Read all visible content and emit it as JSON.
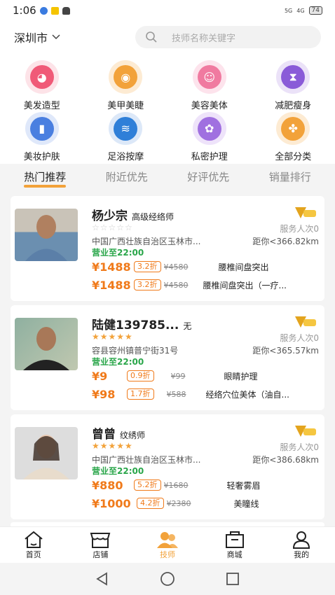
{
  "status": {
    "time": "1:06",
    "signal": "5G",
    "network": "4G",
    "battery": "74"
  },
  "header": {
    "city": "深圳市",
    "search_placeholder": "技师名称关键字"
  },
  "categories": [
    {
      "label": "美发造型",
      "icon": "hair-icon",
      "color": "#f05a78"
    },
    {
      "label": "美甲美睫",
      "icon": "eye-icon",
      "color": "#f2a23a"
    },
    {
      "label": "美容美体",
      "icon": "face-icon",
      "color": "#f07aa0"
    },
    {
      "label": "减肥瘦身",
      "icon": "body-icon",
      "color": "#8a5bd8"
    },
    {
      "label": "美妆护肤",
      "icon": "cosmetics-icon",
      "color": "#4a7fe0"
    },
    {
      "label": "足浴按摩",
      "icon": "foot-massage-icon",
      "color": "#2f7fd8"
    },
    {
      "label": "私密护理",
      "icon": "flower-icon",
      "color": "#a070e0"
    },
    {
      "label": "全部分类",
      "icon": "all-categories-icon",
      "color": "#f2a23a"
    }
  ],
  "tabs": [
    "热门推荐",
    "附近优先",
    "好评优先",
    "销量排行"
  ],
  "technicians": [
    {
      "name": "杨少宗",
      "level": "高级经络师",
      "stars": "☆☆☆☆☆",
      "served": "服务人次0",
      "address": "中国广西壮族自治区玉林市...",
      "distance": "距你<366.82km",
      "hours": "营业至22:00",
      "services": [
        {
          "price": "¥1488",
          "discount": "3.2折",
          "original": "¥4580",
          "name": "腰椎间盘突出"
        },
        {
          "price": "¥1488",
          "discount": "3.2折",
          "original": "¥4580",
          "name": "腰椎间盘突出（一疗..."
        }
      ]
    },
    {
      "name": "陆健139785...",
      "level": "无",
      "stars": "★★★★★",
      "served": "服务人次0",
      "address": "容县容州镇普宁街31号",
      "distance": "距你<365.57km",
      "hours": "营业至22:00",
      "services": [
        {
          "price": "¥9",
          "discount": "0.9折",
          "original": "¥99",
          "name": "眼睛护理"
        },
        {
          "price": "¥98",
          "discount": "1.7折",
          "original": "¥588",
          "name": "经络穴位美体（油自..."
        }
      ]
    },
    {
      "name": "曾曾",
      "level": "纹绣师",
      "stars": "★★★★★",
      "served": "服务人次0",
      "address": "中国广西壮族自治区玉林市...",
      "distance": "距你<386.68km",
      "hours": "营业至22:00",
      "services": [
        {
          "price": "¥880",
          "discount": "5.2折",
          "original": "¥1680",
          "name": "轻奢雾眉"
        },
        {
          "price": "¥1000",
          "discount": "4.2折",
          "original": "¥2380",
          "name": "美瞳线"
        }
      ]
    }
  ],
  "nav": [
    {
      "label": "首页",
      "icon": "home-icon"
    },
    {
      "label": "店铺",
      "icon": "store-icon"
    },
    {
      "label": "技师",
      "icon": "technician-icon"
    },
    {
      "label": "商城",
      "icon": "mall-icon"
    },
    {
      "label": "我的",
      "icon": "profile-icon"
    }
  ],
  "colors": {
    "accent": "#f2a23a",
    "price": "#f07a1a",
    "open": "#2aa64a"
  }
}
